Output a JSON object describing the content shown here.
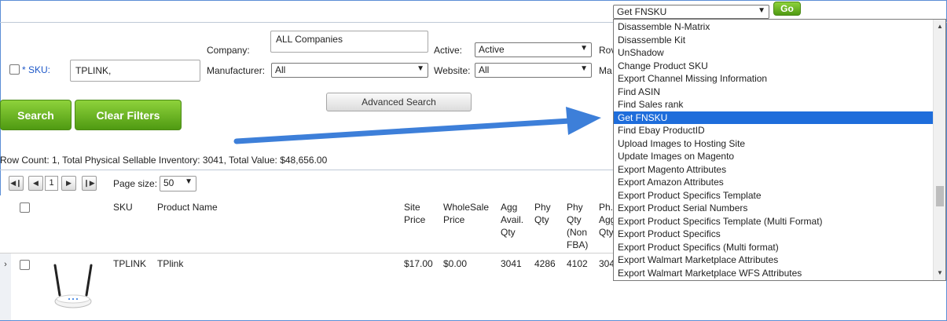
{
  "action_bar": {
    "selected_action": "Get FNSKU",
    "go_label": "Go"
  },
  "filters": {
    "sku_label": "* SKU:",
    "sku_value": "TPLINK,",
    "company_label": "Company:",
    "company_value": "ALL Companies",
    "manufacturer_label": "Manufacturer:",
    "manufacturer_value": "All",
    "active_label": "Active:",
    "active_value": "Active",
    "website_label": "Website:",
    "website_value": "All",
    "row_label_partial": "Rov",
    "ma_label_partial": "Ma"
  },
  "buttons": {
    "search": "Search",
    "clear_filters": "Clear Filters",
    "advanced_search": "Advanced Search"
  },
  "summary": "Row Count: 1, Total Physical Sellable Inventory: 3041, Total Value: $48,656.00",
  "pager": {
    "page": "1",
    "page_size_label": "Page size:",
    "page_size": "50"
  },
  "table": {
    "headers": {
      "sku": "SKU",
      "product_name": "Product Name",
      "site_price_1": "Site",
      "site_price_2": "Price",
      "wholesale_1": "WholeSale",
      "wholesale_2": "Price",
      "agg_1": "Agg",
      "agg_2": "Avail.",
      "agg_3": "Qty",
      "phy_1": "Phy",
      "phy_2": "Qty",
      "phynon_1": "Phy",
      "phynon_2": "Qty",
      "phynon_3": "(Non",
      "phynon_4": "FBA)",
      "ph_1": "Ph.",
      "ph_2": "Agg",
      "ph_3": "Qty"
    },
    "row": {
      "sku": "TPLINK",
      "product_name": "TPlink",
      "site_price": "$17.00",
      "wholesale_price": "$0.00",
      "agg_qty": "3041",
      "phy_qty": "4286",
      "phy_non_fba": "4102",
      "ph_agg_partial": "304"
    }
  },
  "dropdown_items": [
    "Disassemble N-Matrix",
    "Disassemble Kit",
    "UnShadow",
    "Change Product SKU",
    "Export Channel Missing Information",
    "Find ASIN",
    "Find Sales rank",
    "Get FNSKU",
    "Find Ebay ProductID",
    "Upload Images to Hosting Site",
    "Update Images on Magento",
    "Export Magento Attributes",
    "Export Amazon Attributes",
    "Export Product Specifics Template",
    "Export Product Serial Numbers",
    "Export Product Specifics Template (Multi Format)",
    "Export Product Specifics",
    "Export Product Specifics (Multi format)",
    "Export Walmart Marketplace Attributes",
    "Export Walmart Marketplace WFS Attributes"
  ],
  "highlighted_item": "Get FNSKU",
  "colors": {
    "accent_blue": "#1e6ddb",
    "green": "#5aa918",
    "arrow": "#3d7fd9"
  }
}
